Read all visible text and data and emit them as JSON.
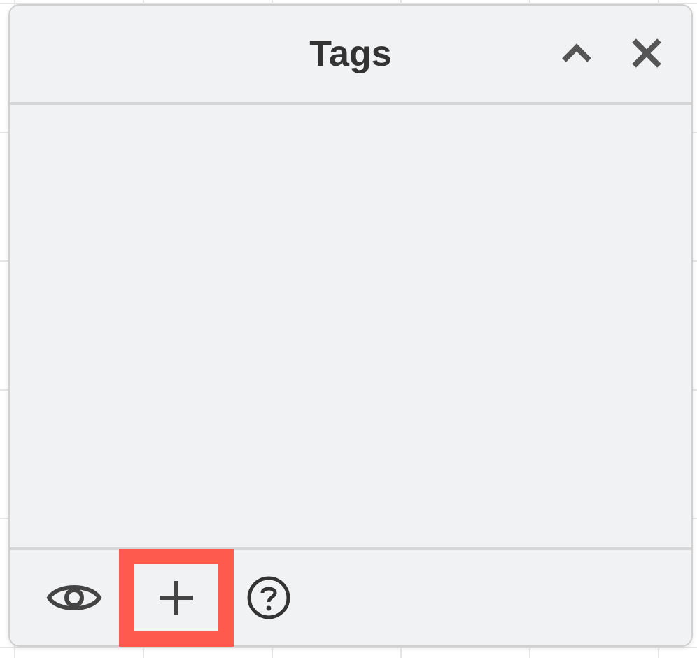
{
  "panel": {
    "title": "Tags",
    "collapsed": false
  },
  "footer_tools": [
    {
      "kind": "visibility",
      "highlighted": false
    },
    {
      "kind": "add",
      "highlighted": true
    },
    {
      "kind": "help",
      "highlighted": false
    }
  ]
}
